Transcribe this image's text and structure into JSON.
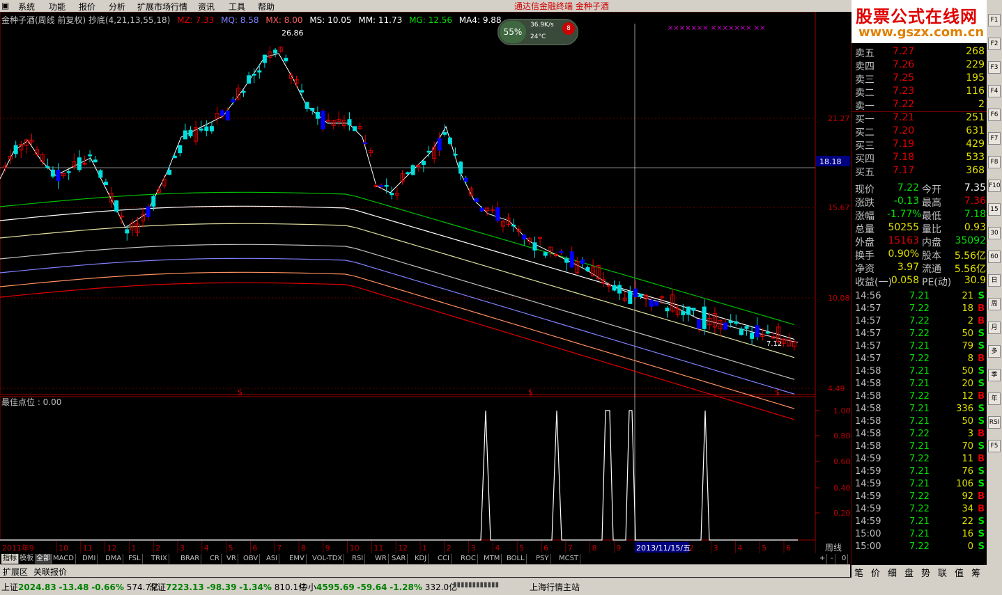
{
  "menu": [
    "系统",
    "功能",
    "报价",
    "分析",
    "扩展市场行情",
    "资讯",
    "工具",
    "帮助"
  ],
  "menu_center": "通达信金融终端   金种子酒",
  "logo": {
    "line1": "股票公式在线网",
    "line2": "www.gszx.com.cn"
  },
  "info": {
    "title": "金种子酒(周线 前复权) 抄底(4,21,13,55,18)",
    "mz": "MZ: 7.33",
    "mq": "MQ: 8.58",
    "mx": "MX: 8.00",
    "ms": "MS: 10.05",
    "mm": "MM: 11.73",
    "mg": "MG: 12.56",
    "ma4": "MA4: 9.88"
  },
  "weather": {
    "pct": "55%",
    "speed": "36.9K/s",
    "temp": "24°C",
    "badge": "8"
  },
  "price_axis": [
    "21.27",
    "15.67",
    "10.08",
    "4.49"
  ],
  "cursor_price": "18.18",
  "peak_label": "26.86",
  "low_label": "7.12",
  "xmarks": "×××××××  ×××××××  ××",
  "sub": {
    "label": "最佳点位 : 0.00",
    "ticks": [
      "1.00",
      "0.80",
      "0.60",
      "0.40",
      "0.20"
    ]
  },
  "xaxis": {
    "year": "2011年9",
    "months": [
      "10",
      "11",
      "12",
      "1",
      "2",
      "3",
      "4",
      "5",
      "6",
      "7",
      "8",
      "9",
      "10",
      "11",
      "12",
      "1",
      "2",
      "3",
      "4",
      "5",
      "6",
      "7",
      "8",
      "9",
      "10",
      "11",
      "2",
      "3",
      "4",
      "5",
      "6"
    ],
    "cursor_date": "2013/11/15/五",
    "period": "周线"
  },
  "quotes": [
    {
      "label": "卖五",
      "price": "7.27",
      "vol": "268"
    },
    {
      "label": "卖四",
      "price": "7.26",
      "vol": "229"
    },
    {
      "label": "卖三",
      "price": "7.25",
      "vol": "195"
    },
    {
      "label": "卖二",
      "price": "7.23",
      "vol": "116"
    },
    {
      "label": "卖一",
      "price": "7.22",
      "vol": "2"
    },
    {
      "label": "买一",
      "price": "7.21",
      "vol": "251"
    },
    {
      "label": "买二",
      "price": "7.20",
      "vol": "631"
    },
    {
      "label": "买三",
      "price": "7.19",
      "vol": "429"
    },
    {
      "label": "买四",
      "price": "7.18",
      "vol": "533"
    },
    {
      "label": "买五",
      "price": "7.17",
      "vol": "368"
    }
  ],
  "stats": [
    {
      "l1": "现价",
      "v1": "7.22",
      "l2": "今开",
      "v2": "7.35",
      "c1": "#00e000",
      "c2": "#ffffff"
    },
    {
      "l1": "涨跌",
      "v1": "-0.13",
      "l2": "最高",
      "v2": "7.36",
      "c1": "#00e000",
      "c2": "#e00000"
    },
    {
      "l1": "涨幅",
      "v1": "-1.77%",
      "l2": "最低",
      "v2": "7.18",
      "c1": "#00e000",
      "c2": "#00e000"
    },
    {
      "l1": "总量",
      "v1": "50255",
      "l2": "量比",
      "v2": "0.93",
      "c1": "#e0e000",
      "c2": "#e0e000"
    },
    {
      "l1": "外盘",
      "v1": "15163",
      "l2": "内盘",
      "v2": "35092",
      "c1": "#e00000",
      "c2": "#00e000"
    },
    {
      "l1": "换手",
      "v1": "0.90%",
      "l2": "股本",
      "v2": "5.56亿",
      "c1": "#e0e000",
      "c2": "#e0e000"
    },
    {
      "l1": "净资",
      "v1": "3.97",
      "l2": "流通",
      "v2": "5.56亿",
      "c1": "#e0e000",
      "c2": "#e0e000"
    },
    {
      "l1": "收益(一)",
      "v1": "0.058",
      "l2": "PE(动)",
      "v2": "30.9",
      "c1": "#e0e000",
      "c2": "#e0e000"
    }
  ],
  "ticks": [
    [
      "14:56",
      "7.21",
      "21",
      "S"
    ],
    [
      "14:57",
      "7.22",
      "18",
      "B"
    ],
    [
      "14:57",
      "7.22",
      "2",
      "B"
    ],
    [
      "14:57",
      "7.22",
      "50",
      "S"
    ],
    [
      "14:57",
      "7.21",
      "79",
      "S"
    ],
    [
      "14:57",
      "7.22",
      "8",
      "B"
    ],
    [
      "14:58",
      "7.21",
      "50",
      "S"
    ],
    [
      "14:58",
      "7.21",
      "20",
      "S"
    ],
    [
      "14:58",
      "7.22",
      "12",
      "B"
    ],
    [
      "14:58",
      "7.21",
      "336",
      "S"
    ],
    [
      "14:58",
      "7.21",
      "50",
      "S"
    ],
    [
      "14:58",
      "7.22",
      "3",
      "B"
    ],
    [
      "14:58",
      "7.21",
      "70",
      "S"
    ],
    [
      "14:59",
      "7.22",
      "11",
      "B"
    ],
    [
      "14:59",
      "7.21",
      "76",
      "S"
    ],
    [
      "14:59",
      "7.21",
      "106",
      "S"
    ],
    [
      "14:59",
      "7.22",
      "92",
      "B"
    ],
    [
      "14:59",
      "7.22",
      "34",
      "B"
    ],
    [
      "14:59",
      "7.21",
      "22",
      "S"
    ],
    [
      "15:00",
      "7.21",
      "16",
      "S"
    ],
    [
      "15:00",
      "7.22",
      "0",
      "S"
    ]
  ],
  "tabs": [
    "指标",
    "模板",
    "全部",
    "MACD",
    "DMI",
    "DMA",
    "FSL",
    "TRIX",
    "BRAR",
    "CR",
    "VR",
    "OBV",
    "ASI",
    "EMV",
    "VOL-TDX",
    "RSI",
    "WR",
    "SAR",
    "KDJ",
    "CCI",
    "ROC",
    "MTM",
    "BOLL",
    "PSY",
    "MCST"
  ],
  "rowbar": [
    "扩展区",
    "关联报价"
  ],
  "zoom": [
    "+",
    "-",
    "0"
  ],
  "bottomtabs": [
    "笔",
    "价",
    "细",
    "盘",
    "势",
    "联",
    "值",
    "筹"
  ],
  "sidebar": [
    "F1",
    "F2",
    "F3",
    "F4",
    "F6",
    "F7",
    "F8",
    "F10",
    "15",
    "30",
    "60",
    "日",
    "周",
    "月",
    "多",
    "季",
    "年",
    "RSI",
    "F5"
  ],
  "status": {
    "sh_label": "上证",
    "sh": "2024.83",
    "sh_chg": "-13.48",
    "sh_pct": "-0.66%",
    "sh_amt": "574.7亿",
    "sz_label": "深证",
    "sz": "7223.13",
    "sz_chg": "-98.39",
    "sz_pct": "-1.34%",
    "sz_amt": "810.1亿",
    "zx_label": "中小",
    "zx": "4595.69",
    "zx_chg": "-59.64",
    "zx_pct": "-1.28%",
    "zx_amt": "332.0亿",
    "station": "上海行情主站"
  },
  "colors": {
    "up": "#e00000",
    "down": "#00e0e0",
    "accent_bar": "#0000ff"
  }
}
